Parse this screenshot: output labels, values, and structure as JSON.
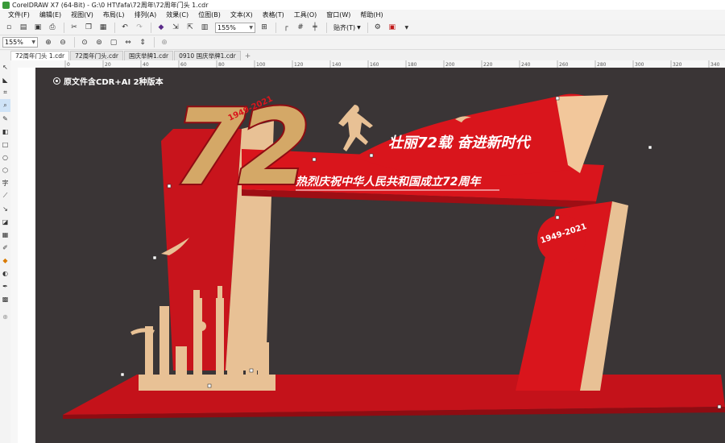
{
  "window": {
    "title": "CorelDRAW X7 (64-Bit) - G:\\0 HT\\fafa\\72周年\\72周年门头 1.cdr"
  },
  "menu": [
    "文件(F)",
    "编辑(E)",
    "视图(V)",
    "布局(L)",
    "排列(A)",
    "效果(C)",
    "位图(B)",
    "文本(X)",
    "表格(T)",
    "工具(O)",
    "窗口(W)",
    "帮助(H)"
  ],
  "toolbar": {
    "zoom_value": "155%",
    "snap_label": "贴齐(T)",
    "icons": [
      "new-icon",
      "open-icon",
      "save-icon",
      "print-icon",
      "cut-icon",
      "copy-icon",
      "paste-icon",
      "undo-icon",
      "redo-icon",
      "search-content-icon",
      "import-icon",
      "export-icon",
      "publish-icon",
      "zoom-combo",
      "fullscreen-icon",
      "rulers-icon",
      "grid-icon",
      "guidelines-icon",
      "snap-button",
      "options-icon",
      "launch-icon"
    ]
  },
  "property_bar": {
    "zoom_value": "155%"
  },
  "tabs": [
    {
      "label": "72周年门头 1.cdr",
      "active": true
    },
    {
      "label": "72周年门头.cdr",
      "active": false
    },
    {
      "label": "国庆举牌1.cdr",
      "active": false
    },
    {
      "label": "0910 国庆举牌1.cdr",
      "active": false
    }
  ],
  "ruler_ticks": [
    "0",
    "20",
    "40",
    "60",
    "80",
    "100",
    "120",
    "140",
    "160",
    "180",
    "200",
    "220",
    "240",
    "260",
    "280",
    "300",
    "320",
    "340"
  ],
  "canvas": {
    "note": "原文件含CDR+AI 2种版本",
    "big_number": "72",
    "years_badge": "1949-2021",
    "slogan_main": "壮丽72载 奋进新时代",
    "slogan_sub": "热烈庆祝中华人民共和国成立72周年",
    "badge_right": "1949-2021",
    "background_color": "#3a3536",
    "accent_red": "#d9151c",
    "accent_gold": "#e8c195"
  }
}
